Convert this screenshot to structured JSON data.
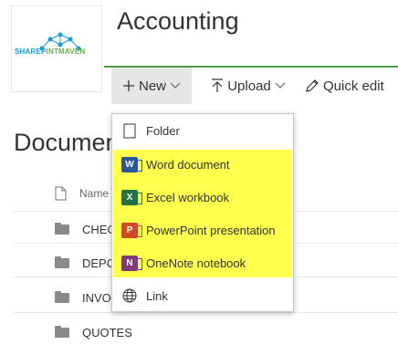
{
  "site": {
    "title": "Accounting",
    "logo_text_a": "SHAREP",
    "logo_text_b": "INTMAVEN"
  },
  "commandbar": {
    "new_label": "New",
    "upload_label": "Upload",
    "quick_edit_label": "Quick edit"
  },
  "library": {
    "title": "Documen",
    "name_header": "Name",
    "rows": [
      {
        "label": "CHEC"
      },
      {
        "label": "DEPC"
      },
      {
        "label": "INVO"
      },
      {
        "label": "QUOTES"
      }
    ]
  },
  "new_menu": {
    "items": [
      {
        "label": "Folder",
        "icon": "folder-icon"
      },
      {
        "label": "Word document",
        "icon": "word-icon"
      },
      {
        "label": "Excel workbook",
        "icon": "excel-icon"
      },
      {
        "label": "PowerPoint presentation",
        "icon": "powerpoint-icon"
      },
      {
        "label": "OneNote notebook",
        "icon": "onenote-icon"
      },
      {
        "label": "Link",
        "icon": "globe-icon"
      }
    ]
  },
  "colors": {
    "accent_green": "#4a9f3e",
    "highlight": "#ffff4d",
    "word": "#2b579a",
    "excel": "#217346",
    "powerpoint": "#d24726",
    "onenote": "#80397b"
  }
}
